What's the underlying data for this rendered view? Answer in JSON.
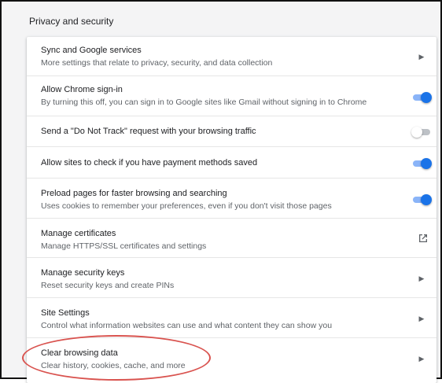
{
  "section": {
    "title": "Privacy and security"
  },
  "rows": [
    {
      "title": "Sync and Google services",
      "subtitle": "More settings that relate to privacy, security, and data collection",
      "control": "chevron"
    },
    {
      "title": "Allow Chrome sign-in",
      "subtitle": "By turning this off, you can sign in to Google sites like Gmail without signing in to Chrome",
      "control": "toggle",
      "state": "on"
    },
    {
      "title": "Send a \"Do Not Track\" request with your browsing traffic",
      "control": "toggle",
      "state": "off"
    },
    {
      "title": "Allow sites to check if you have payment methods saved",
      "control": "toggle",
      "state": "on"
    },
    {
      "title": "Preload pages for faster browsing and searching",
      "subtitle": "Uses cookies to remember your preferences, even if you don't visit those pages",
      "control": "toggle",
      "state": "on"
    },
    {
      "title": "Manage certificates",
      "subtitle": "Manage HTTPS/SSL certificates and settings",
      "control": "external-link"
    },
    {
      "title": "Manage security keys",
      "subtitle": "Reset security keys and create PINs",
      "control": "chevron"
    },
    {
      "title": "Site Settings",
      "subtitle": "Control what information websites can use and what content they can show you",
      "control": "chevron"
    },
    {
      "title": "Clear browsing data",
      "subtitle": "Clear history, cookies, cache, and more",
      "control": "chevron",
      "highlighted": true
    }
  ],
  "icons": {
    "chevron": "chevron-right-icon",
    "external": "open-in-new-icon"
  },
  "colors": {
    "accent": "#1a73e8",
    "accent_track": "#8ab4f8",
    "highlight": "#d9534f"
  }
}
